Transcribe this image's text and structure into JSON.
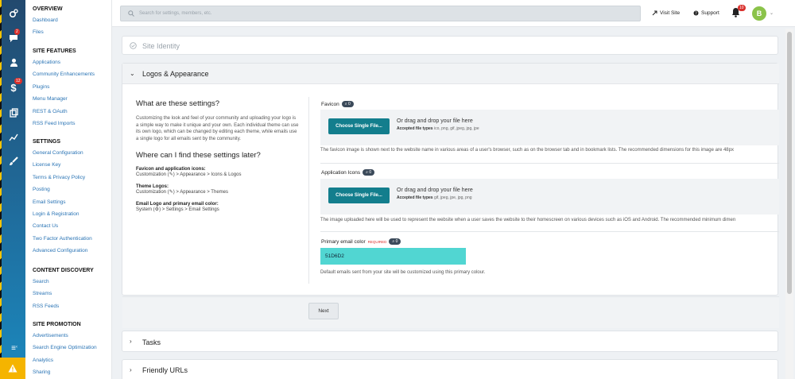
{
  "iconbar": {
    "items": [
      {
        "icon": "cogs-icon"
      },
      {
        "icon": "chat-icon",
        "badge": "2"
      },
      {
        "icon": "user-icon"
      },
      {
        "icon": "dollar-icon",
        "badge": "12"
      },
      {
        "icon": "copy-icon"
      },
      {
        "icon": "chart-icon"
      },
      {
        "icon": "brush-icon"
      }
    ],
    "bottom": [
      {
        "icon": "menu-icon"
      },
      {
        "icon": "warning-icon"
      }
    ]
  },
  "sidebar": {
    "sections": [
      {
        "title": "OVERVIEW",
        "items": [
          "Dashboard",
          "Files"
        ]
      },
      {
        "title": "SITE FEATURES",
        "items": [
          "Applications",
          "Community Enhancements",
          "Plugins",
          "Menu Manager",
          "REST & OAuth",
          "RSS Feed Imports"
        ]
      },
      {
        "title": "SETTINGS",
        "items": [
          "General Configuration",
          "License Key",
          "Terms & Privacy Policy",
          "Posting",
          "Email Settings",
          "Login & Registration",
          "Contact Us",
          "Two Factor Authentication",
          "Advanced Configuration"
        ]
      },
      {
        "title": "CONTENT DISCOVERY",
        "items": [
          "Search",
          "Streams",
          "RSS Feeds"
        ]
      },
      {
        "title": "SITE PROMOTION",
        "items": [
          "Advertisements",
          "Search Engine Optimization",
          "Analytics",
          "Sharing"
        ]
      }
    ]
  },
  "topbar": {
    "search_placeholder": "Search for settings, members, etc.",
    "visit_site": "Visit Site",
    "support": "Support",
    "notifications": "10",
    "avatar_letter": "B"
  },
  "panels": {
    "site_identity": "Site Identity",
    "logos": "Logos & Appearance",
    "tasks": "Tasks",
    "friendly_urls": "Friendly URLs"
  },
  "help": {
    "title1": "What are these settings?",
    "body": "Customizing the look and feel of your community and uploading your logo is a simple way to make it unique and your own. Each individual theme can use its own logo, which can be changed by editing each theme, while emails use a single logo for all emails sent by the community.",
    "title2": "Where can I find these settings later?",
    "items": [
      {
        "label": "Favicon and application icons:",
        "path_pre": "Customization (",
        "path_post": ") > Appearance > Icons & Logos"
      },
      {
        "label": "Theme Logos:",
        "path_pre": "Customization (",
        "path_post": ") > Appearance > Themes"
      },
      {
        "label": "Email Logo and primary email color:",
        "path_pre": "System (",
        "path_post": ") > Settings > Email Settings"
      }
    ]
  },
  "fields": {
    "favicon": {
      "label": "Favicon",
      "badge": "0",
      "button": "Choose Single File...",
      "drop": "Or drag and drop your file here",
      "types_label": "Accepted file types",
      "types": "ico, png, gif, jpeg, jpg, jpe",
      "desc": "The favicon image is shown next to the website name in various areas of a user's browser, such as on the browser tab and in bookmark lists. The recommended dimensions for this image are 48px"
    },
    "app_icons": {
      "label": "Application Icons",
      "badge": "0",
      "button": "Choose Single File...",
      "drop": "Or drag and drop your file here",
      "types_label": "Accepted file types",
      "types": "gif, jpeg, jpe, jpg, png",
      "desc": "The image uploaded here will be used to represent the website when a user saves the website to their homescreen on various devices such as iOS and Android. The recommended minimum dimen"
    },
    "email_color": {
      "label": "Primary email color",
      "required": "REQUIRED",
      "badge": "0",
      "value": "51D6D2",
      "desc": "Default emails sent from your site will be customized using this primary colour."
    }
  },
  "next_label": "Next",
  "colors": {
    "accent": "#137e8d",
    "email_color": "#51d6d2",
    "link": "#2a74b5"
  }
}
